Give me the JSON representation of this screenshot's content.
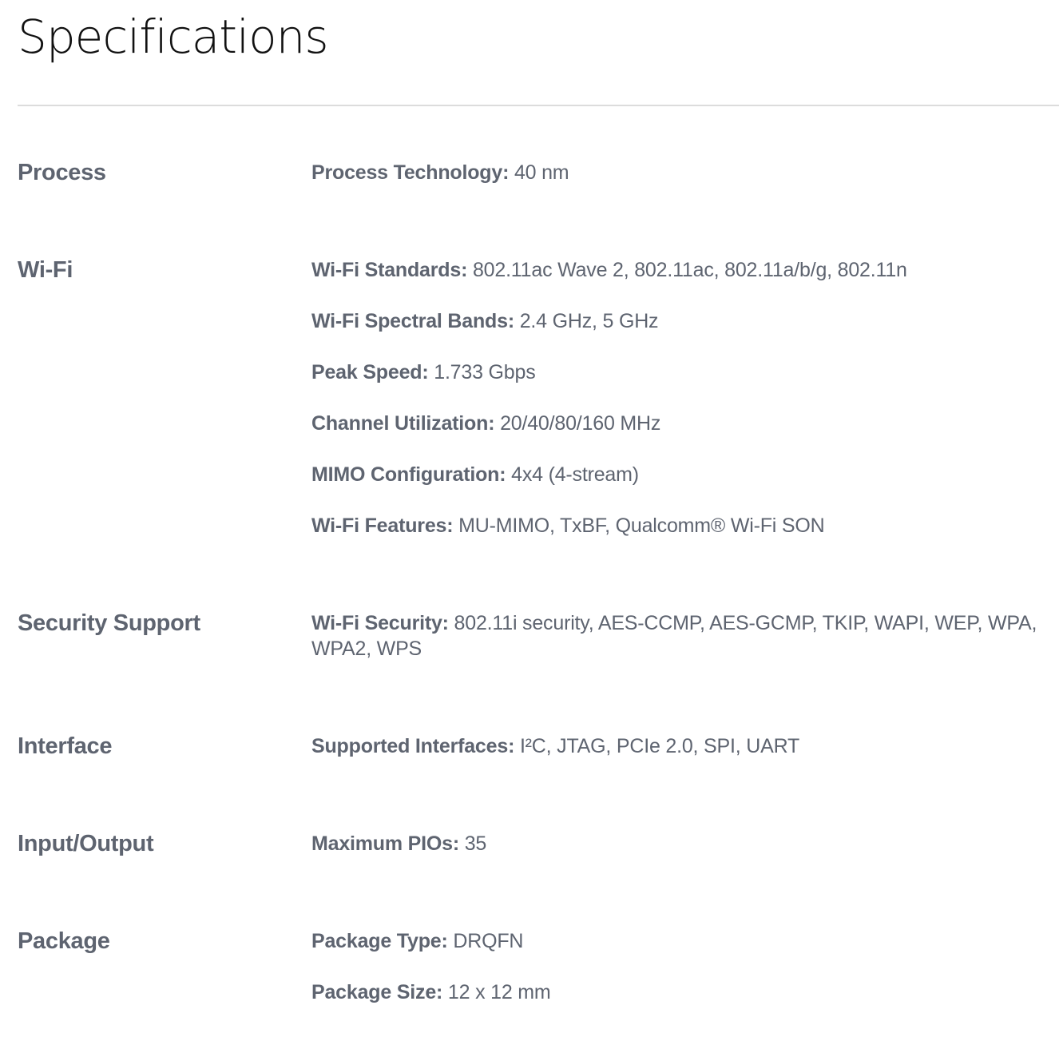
{
  "title": "Specifications",
  "sections": [
    {
      "label": "Process",
      "items": [
        {
          "key": "Process Technology",
          "value": "40 nm"
        }
      ]
    },
    {
      "label": "Wi-Fi",
      "items": [
        {
          "key": "Wi-Fi Standards",
          "value": "802.11ac Wave 2, 802.11ac, 802.11a/b/g, 802.11n"
        },
        {
          "key": "Wi-Fi Spectral Bands",
          "value": "2.4 GHz, 5 GHz"
        },
        {
          "key": "Peak Speed",
          "value": "1.733 Gbps"
        },
        {
          "key": "Channel Utilization",
          "value": "20/40/80/160 MHz"
        },
        {
          "key": "MIMO Configuration",
          "value": "4x4 (4-stream)"
        },
        {
          "key": "Wi-Fi Features",
          "value": "MU-MIMO, TxBF, Qualcomm® Wi-Fi SON"
        }
      ]
    },
    {
      "label": "Security Support",
      "items": [
        {
          "key": "Wi-Fi Security",
          "value": "802.11i security, AES-CCMP, AES-GCMP, TKIP, WAPI, WEP, WPA, WPA2, WPS"
        }
      ]
    },
    {
      "label": "Interface",
      "items": [
        {
          "key": "Supported Interfaces",
          "value": "I²C, JTAG, PCIe 2.0, SPI, UART"
        }
      ]
    },
    {
      "label": "Input/Output",
      "items": [
        {
          "key": "Maximum PIOs",
          "value": "35"
        }
      ]
    },
    {
      "label": "Package",
      "items": [
        {
          "key": "Package Type",
          "value": "DRQFN"
        },
        {
          "key": "Package Size",
          "value": "12 x 12 mm"
        }
      ]
    }
  ]
}
